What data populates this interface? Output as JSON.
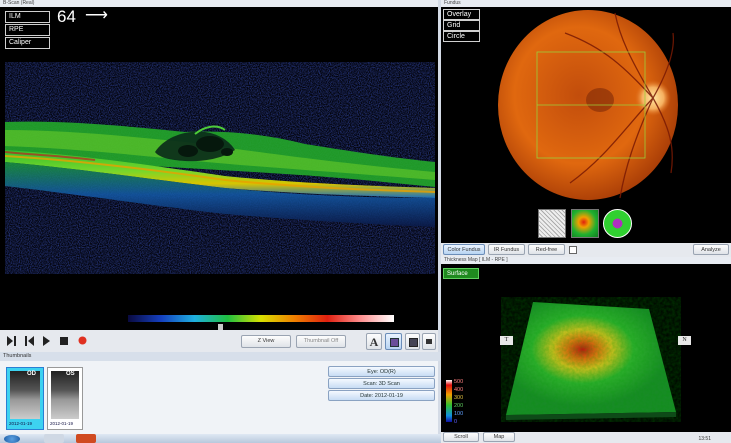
{
  "bscan": {
    "title": "B-Scan (Real)",
    "overlay_buttons": [
      "ILM",
      "RPE",
      "Caliper"
    ],
    "slice_number": "64",
    "arrow": "⟶"
  },
  "player": {
    "view_button": "Z View",
    "thumbnail_button": "Thumbnail Off",
    "font_button": "A"
  },
  "thumbnails": {
    "title": "Thumbnails",
    "items": [
      {
        "label": "OD",
        "date": "2012-01-19"
      },
      {
        "label": "OS",
        "date": "2012-01-19"
      }
    ],
    "side_buttons": [
      "Eye: OD(R)",
      "Scan: 3D Scan",
      "Date: 2012-01-19"
    ]
  },
  "fundus": {
    "title": "Fundus",
    "overlay_buttons": [
      "Overlay",
      "Grid",
      "Circle"
    ],
    "tabs": [
      "Color Fundus",
      "IR Fundus",
      "Red-free"
    ],
    "analyze_button": "Analyze"
  },
  "thickness": {
    "title": "Thickness Map  [ ILM - RPE ]",
    "surface_button": "Surface",
    "left_marker": "T",
    "right_marker": "N",
    "colorbar_labels": [
      "500",
      "400",
      "300",
      "200",
      "100",
      "0"
    ],
    "bottom_buttons": [
      "Scroll",
      "Map"
    ]
  },
  "taskbar": {
    "clock": "13:51"
  },
  "colors": {
    "accent": "#2a7fd4",
    "surface_green": "#1f8a1f",
    "fundus_orange": "#e06a10"
  }
}
